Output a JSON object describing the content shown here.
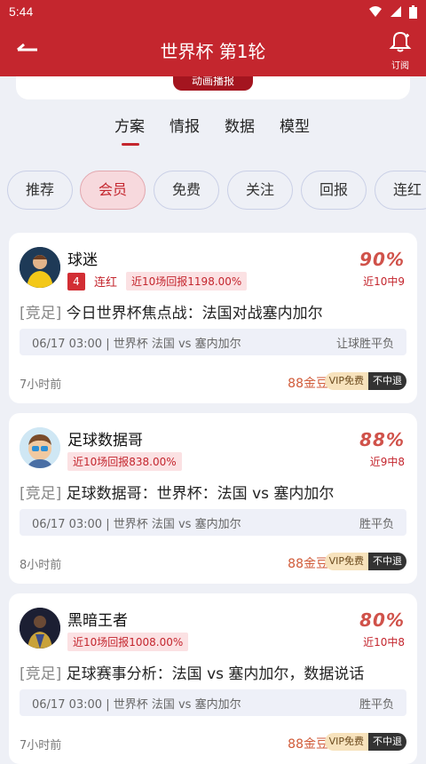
{
  "status": {
    "time": "5:44"
  },
  "appbar": {
    "title": "世界杯 第1轮",
    "subscribe_label": "订阅"
  },
  "top_card": {
    "button": "动画播报"
  },
  "tabs": [
    "方案",
    "情报",
    "数据",
    "模型"
  ],
  "chips": [
    "推荐",
    "会员",
    "免费",
    "关注",
    "回报",
    "连红"
  ],
  "active_chip": 1,
  "cards": [
    {
      "name": "球迷",
      "badge_num": "4",
      "badge_streak": "连红",
      "record": "近10场回报1198.00%",
      "rate": "90%",
      "rate_sub": "近10中9",
      "tag": "[竞足]",
      "headline": "今日世界杯焦点战：法国对战塞内加尔",
      "match": "06/17 03:00 | 世界杯  法国 vs 塞内加尔",
      "market": "让球胜平负",
      "time": "7小时前",
      "price": "88金豆",
      "vip": "VIP免费",
      "refund": "不中退",
      "avatar_color": "#f3c818"
    },
    {
      "name": "足球数据哥",
      "badge_num": "",
      "badge_streak": "",
      "record": "近10场回报838.00%",
      "rate": "88%",
      "rate_sub": "近9中8",
      "tag": "[竞足]",
      "headline": "足球数据哥：世界杯：法国 vs 塞内加尔",
      "match": "06/17 03:00 | 世界杯  法国 vs 塞内加尔",
      "market": "胜平负",
      "time": "8小时前",
      "price": "88金豆",
      "vip": "VIP免费",
      "refund": "不中退",
      "avatar_color": "#cfe7f4"
    },
    {
      "name": "黑暗王者",
      "badge_num": "",
      "badge_streak": "",
      "record": "近10场回报1008.00%",
      "rate": "80%",
      "rate_sub": "近10中8",
      "tag": "[竞足]",
      "headline": "足球赛事分析：法国 vs 塞内加尔，数据说话",
      "match": "06/17 03:00 | 世界杯  法国 vs 塞内加尔",
      "market": "胜平负",
      "time": "7小时前",
      "price": "88金豆",
      "vip": "VIP免费",
      "refund": "不中退",
      "avatar_color": "#2b2f4a"
    }
  ],
  "colors": {
    "brand": "#c4262e",
    "rate": "#d0524a"
  }
}
